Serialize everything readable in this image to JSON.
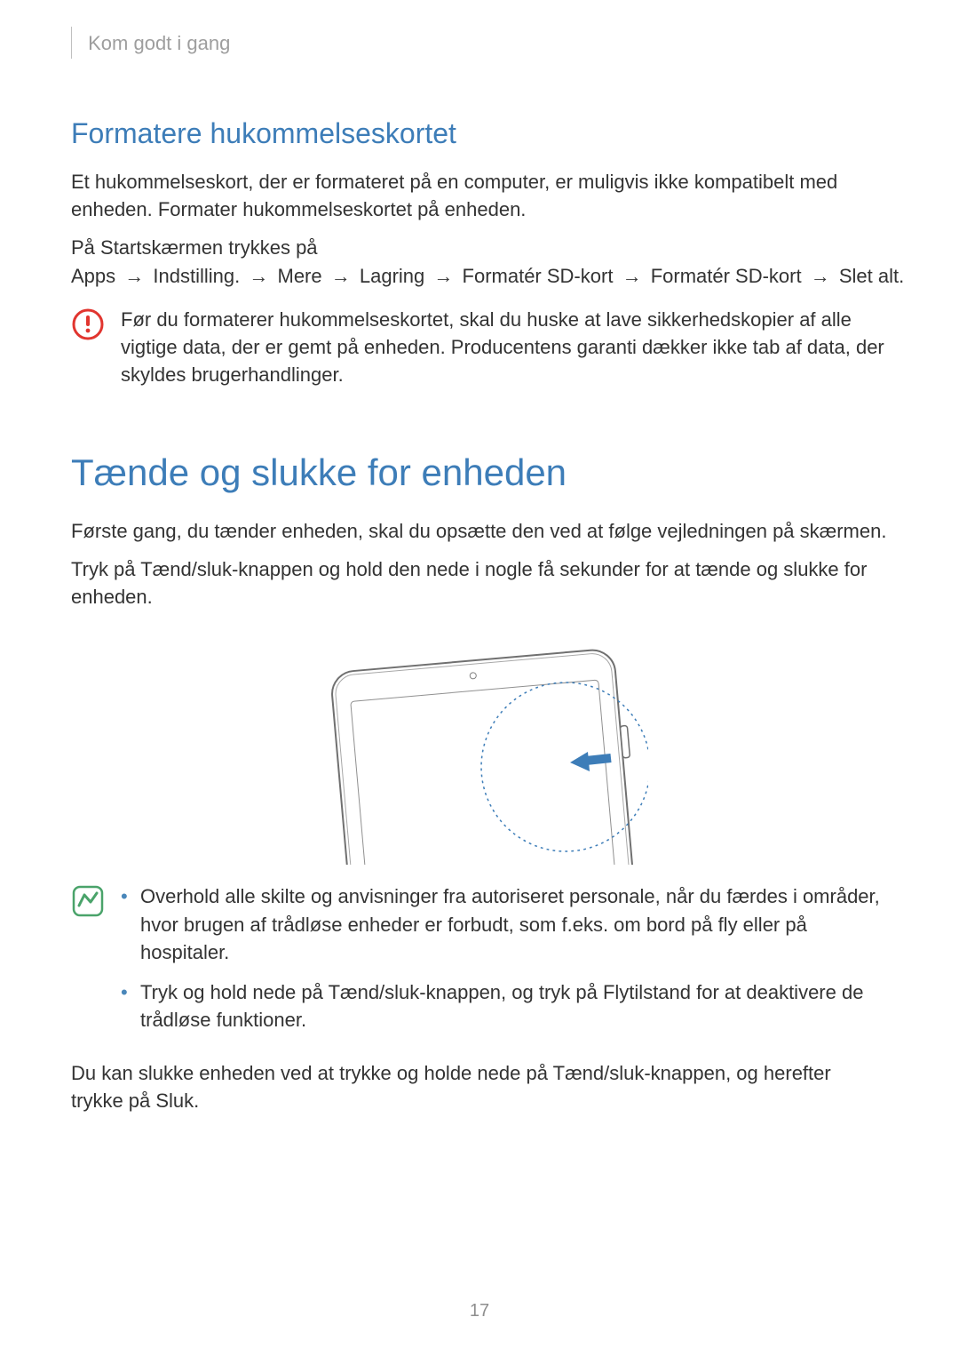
{
  "running_header": "Kom godt i gang",
  "section1": {
    "title": "Formatere hukommelseskortet",
    "p1": "Et hukommelseskort, der er formateret på en computer, er muligvis ikke kompatibelt med enheden. Formater hukommelseskortet på enheden.",
    "path_prefix": "På Startskærmen trykkes på ",
    "path_steps": [
      "Apps",
      "Indstilling.",
      "Mere",
      "Lagring",
      "Formatér SD-kort",
      "Formatér SD-kort",
      "Slet alt"
    ],
    "path_suffix": ".",
    "arrow_glyph": "→",
    "warning": "Før du formaterer hukommelseskortet, skal du huske at lave sikkerhedskopier af alle vigtige data, der er gemt på enheden. Producentens garanti dækker ikke tab af data, der skyldes brugerhandlinger."
  },
  "section2": {
    "title": "Tænde og slukke for enheden",
    "p1": "Første gang, du tænder enheden, skal du opsætte den ved at følge vejledningen på skærmen.",
    "p2": "Tryk på Tænd/sluk-knappen og hold den nede i nogle få sekunder for at tænde og slukke for enheden.",
    "tips": [
      "Overhold alle skilte og anvisninger fra autoriseret personale, når du færdes i områder, hvor brugen af trådløse enheder er forbudt, som f.eks. om bord på fly eller på hospitaler.",
      "Tryk og hold nede på Tænd/sluk-knappen, og tryk på Flytilstand for at deaktivere de trådløse funktioner."
    ],
    "p3": "Du kan slukke enheden ved at trykke og holde nede på Tænd/sluk-knappen, og herefter trykke på Sluk."
  },
  "page_number": "17"
}
